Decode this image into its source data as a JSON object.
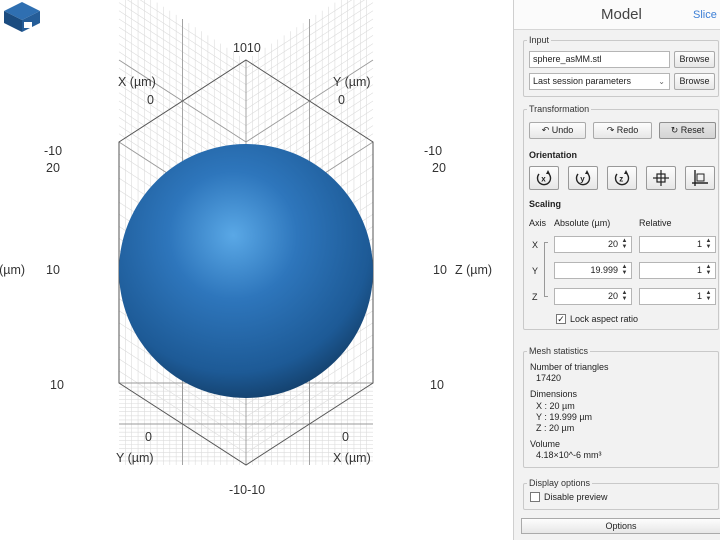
{
  "viewport": {
    "vertices": {
      "top": "1010",
      "bottom": "-10-10",
      "upper_left": "-10",
      "upper_left_2": "20",
      "upper_right": "-10",
      "upper_right_2": "20",
      "lower_left": "10",
      "lower_right": "10"
    },
    "axes": {
      "x_top_label": "X (µm)",
      "x_top_tick": "0",
      "y_top_label": "Y (µm)",
      "y_top_tick": "0",
      "z_left_label": "Z (µm)",
      "z_left_tick": "10",
      "z_right_label": "Z (µm)",
      "z_right_tick": "10",
      "y_bottom_label": "Y (µm)",
      "y_bottom_tick": "0",
      "x_bottom_label": "X (µm)",
      "x_bottom_tick": "0"
    },
    "sphere_color": "#2a6cab",
    "logo_icon": "cube-logo-icon"
  },
  "panel": {
    "tabs": {
      "model": "Model",
      "slice": "Slice"
    },
    "input": {
      "legend": "Input",
      "file_value": "sphere_asMM.stl",
      "browse_label": "Browse",
      "params_value": "Last session parameters",
      "browse2_label": "Browse"
    },
    "transformation": {
      "legend": "Transformation",
      "undo_label": "Undo",
      "redo_label": "Redo",
      "reset_label": "Reset",
      "orientation_title": "Orientation",
      "orientation_icons": [
        "rotate-x-icon",
        "rotate-y-icon",
        "rotate-z-icon",
        "center-move-icon",
        "align-corner-icon"
      ],
      "scaling_title": "Scaling",
      "col_axis": "Axis",
      "col_absolute": "Absolute (µm)",
      "col_relative": "Relative",
      "rows": [
        {
          "axis": "X",
          "absolute": "20",
          "relative": "1"
        },
        {
          "axis": "Y",
          "absolute": "19.999",
          "relative": "1"
        },
        {
          "axis": "Z",
          "absolute": "20",
          "relative": "1"
        }
      ],
      "lock_label": "Lock aspect ratio",
      "lock_checked": true
    },
    "mesh": {
      "legend": "Mesh statistics",
      "triangles_label": "Number of triangles",
      "triangles_value": "17420",
      "dimensions_label": "Dimensions",
      "dim_x": "X : 20 µm",
      "dim_y": "Y : 19.999 µm",
      "dim_z": "Z : 20 µm",
      "volume_label": "Volume",
      "volume_value": "4.18×10^-6 mm³"
    },
    "display": {
      "legend": "Display options",
      "disable_label": "Disable preview",
      "disable_checked": false
    },
    "options_label": "Options"
  }
}
